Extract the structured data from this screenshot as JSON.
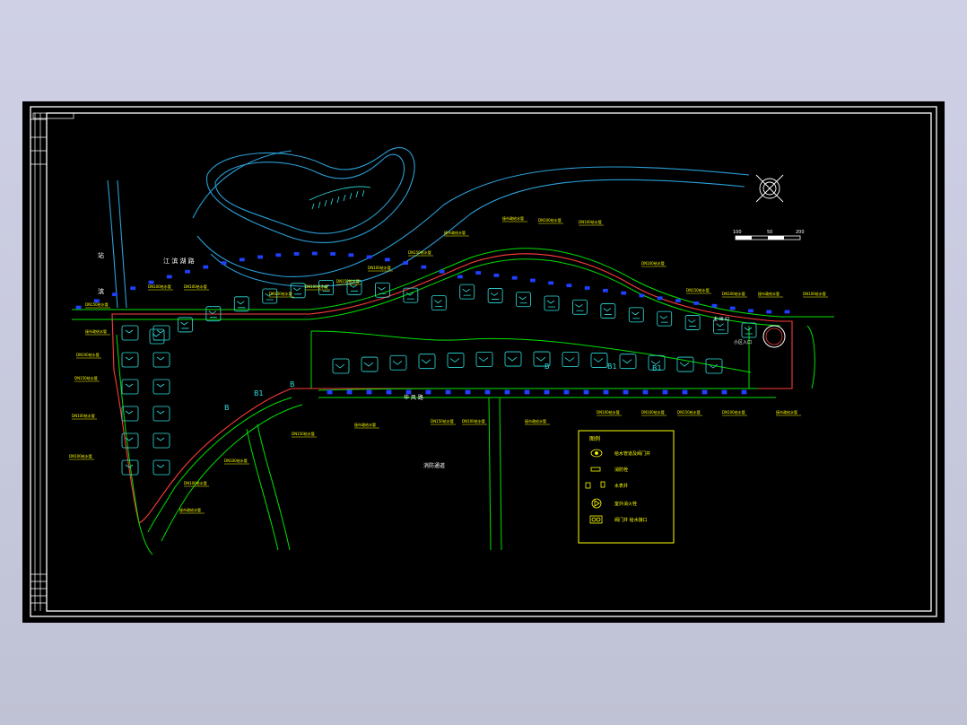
{
  "colors": {
    "background": "#000000",
    "frame": "#ffffff",
    "road": "#00e000",
    "boundary": "#ff3b3b",
    "building": "#30e0e0",
    "annotation": "#ffff00",
    "water": "#2a9fd6",
    "pipe": "#2040ff",
    "title_block": "#ffffff"
  },
  "labels": {
    "lake": "江 滨 湖 路",
    "west_road_top": "站",
    "west_road_bottom": "滨",
    "main_road": "华 风 路",
    "south_area": "消防通道",
    "entrance": "小区入口",
    "gate": "主 出 口"
  },
  "legend": {
    "title": "图例",
    "items": [
      {
        "icon": "manhole-icon",
        "text": "给水管道及阀门井"
      },
      {
        "icon": "valve-icon",
        "text": "消防栓"
      },
      {
        "icon": "meter-icon",
        "text": "水表井"
      },
      {
        "icon": "hydrant-icon",
        "text": "室外消火栓"
      },
      {
        "icon": "tap-icon",
        "text": "阀门井 给水接口"
      }
    ]
  },
  "scale_bar": {
    "ticks": [
      "100",
      "50",
      "200"
    ]
  },
  "building_tags": [
    "B",
    "B1",
    "B",
    "B",
    "B1",
    "B1"
  ],
  "annotation_texts": {
    "top_pipe": "DN100给水管",
    "side_pipe": "DN150给水管",
    "callout": "接市政给水管"
  }
}
